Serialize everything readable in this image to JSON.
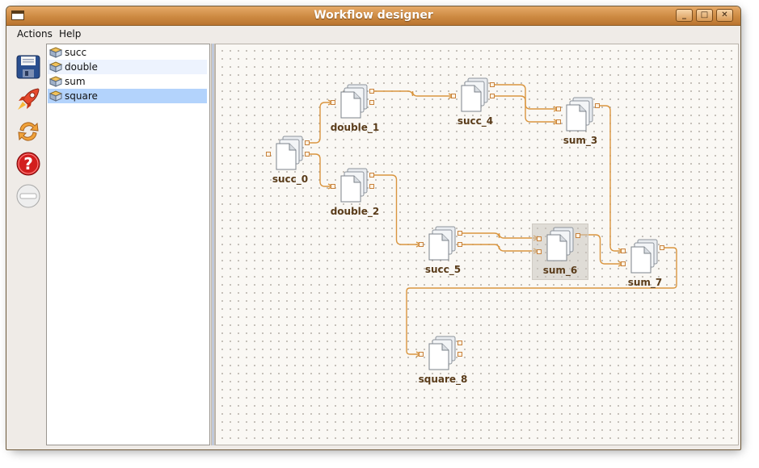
{
  "window": {
    "title": "Workflow designer"
  },
  "menu": [
    "Actions",
    "Help"
  ],
  "toolbar": [
    {
      "icon": "floppy-disk-icon"
    },
    {
      "icon": "rocket-icon"
    },
    {
      "icon": "refresh-arrows-icon"
    },
    {
      "icon": "help-icon"
    },
    {
      "icon": "disabled-stop-icon"
    }
  ],
  "functions": [
    {
      "label": "succ",
      "state": "normal"
    },
    {
      "label": "double",
      "state": "alt"
    },
    {
      "label": "sum",
      "state": "normal"
    },
    {
      "label": "square",
      "state": "selected"
    }
  ],
  "workflow": {
    "nodes": [
      {
        "id": "succ_0",
        "label": "succ_0"
      },
      {
        "id": "double_1",
        "label": "double_1"
      },
      {
        "id": "double_2",
        "label": "double_2"
      },
      {
        "id": "succ_4",
        "label": "succ_4"
      },
      {
        "id": "sum_3",
        "label": "sum_3"
      },
      {
        "id": "succ_5",
        "label": "succ_5"
      },
      {
        "id": "sum_6",
        "label": "sum_6",
        "selected": true
      },
      {
        "id": "sum_7",
        "label": "sum_7"
      },
      {
        "id": "square_8",
        "label": "square_8"
      }
    ],
    "edges": [
      [
        "succ_0",
        "double_1"
      ],
      [
        "succ_0",
        "double_2"
      ],
      [
        "double_1",
        "succ_4"
      ],
      [
        "succ_4",
        "sum_3"
      ],
      [
        "succ_4",
        "sum_3"
      ],
      [
        "double_2",
        "succ_5"
      ],
      [
        "succ_5",
        "sum_6"
      ],
      [
        "succ_5",
        "sum_6"
      ],
      [
        "sum_3",
        "sum_7"
      ],
      [
        "sum_6",
        "sum_7"
      ],
      [
        "sum_7",
        "square_8"
      ]
    ]
  },
  "colors": {
    "titlebar": "#cd8a42",
    "wire": "#d9953f",
    "node_label": "#5a3c1a",
    "selection": "#b3d3fc"
  }
}
